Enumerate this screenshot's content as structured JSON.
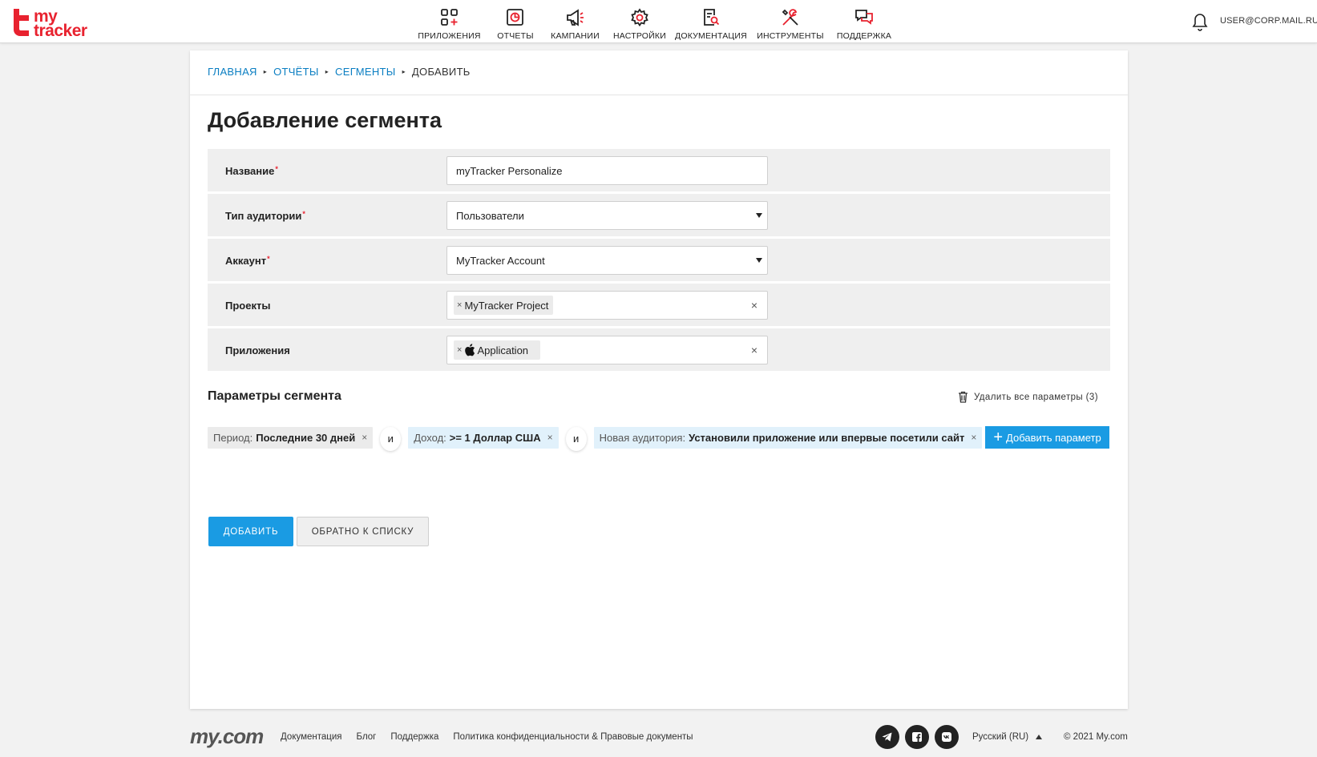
{
  "header": {
    "logo": {
      "line1": "my",
      "line2": "tracker"
    },
    "nav": [
      {
        "label": "ПРИЛОЖЕНИЯ",
        "icon": "apps-icon"
      },
      {
        "label": "ОТЧЕТЫ",
        "icon": "reports-icon"
      },
      {
        "label": "КАМПАНИИ",
        "icon": "megaphone-icon"
      },
      {
        "label": "НАСТРОЙКИ",
        "icon": "gear-icon"
      },
      {
        "label": "ДОКУМЕНТАЦИЯ",
        "icon": "document-search-icon"
      },
      {
        "label": "ИНСТРУМЕНТЫ",
        "icon": "tools-icon"
      },
      {
        "label": "ПОДДЕРЖКА",
        "icon": "chat-icon"
      }
    ],
    "user_email": "USER@CORP.MAIL.RU"
  },
  "breadcrumb": {
    "items": [
      "ГЛАВНАЯ",
      "ОТЧЁТЫ",
      "СЕГМЕНТЫ"
    ],
    "current": "ДОБАВИТЬ"
  },
  "page_title": "Добавление сегмента",
  "form": {
    "name": {
      "label": "Название",
      "value": "myTracker Personalize"
    },
    "audience_type": {
      "label": "Тип аудитории",
      "value": "Пользователи"
    },
    "account": {
      "label": "Аккаунт",
      "value": "MyTracker Account"
    },
    "projects": {
      "label": "Проекты",
      "chip": "MyTracker Project"
    },
    "applications": {
      "label": "Приложения",
      "chip": "Application"
    },
    "required_mark": "*",
    "chip_remove": "×",
    "clear": "×"
  },
  "params": {
    "title": "Параметры сегмента",
    "delete_all": "Удалить все параметры (3)",
    "and": "и",
    "items": [
      {
        "key": "Период:",
        "value": "Последние 30 дней"
      },
      {
        "key": "Доход:",
        "value": ">= 1 Доллар США"
      },
      {
        "key": "Новая аудитория:",
        "value": "Установили приложение или впервые посетили сайт"
      }
    ],
    "remove": "×",
    "add_label": "Добавить параметр"
  },
  "buttons": {
    "add": "ДОБАВИТЬ",
    "back": "ОБРАТНО К СПИСКУ"
  },
  "footer": {
    "brand": "my.com",
    "links": [
      "Документация",
      "Блог",
      "Поддержка",
      "Политика конфиденциальности & Правовые документы"
    ],
    "socials": [
      "telegram-icon",
      "facebook-icon",
      "vk-icon"
    ],
    "language": "Русский (RU)",
    "copyright": "© 2021 My.com"
  },
  "colors": {
    "brand_red": "#e8222f",
    "link_blue": "#0a7ec2",
    "primary_button": "#1a9be3",
    "tag_blue_bg": "#e1f1fb"
  }
}
